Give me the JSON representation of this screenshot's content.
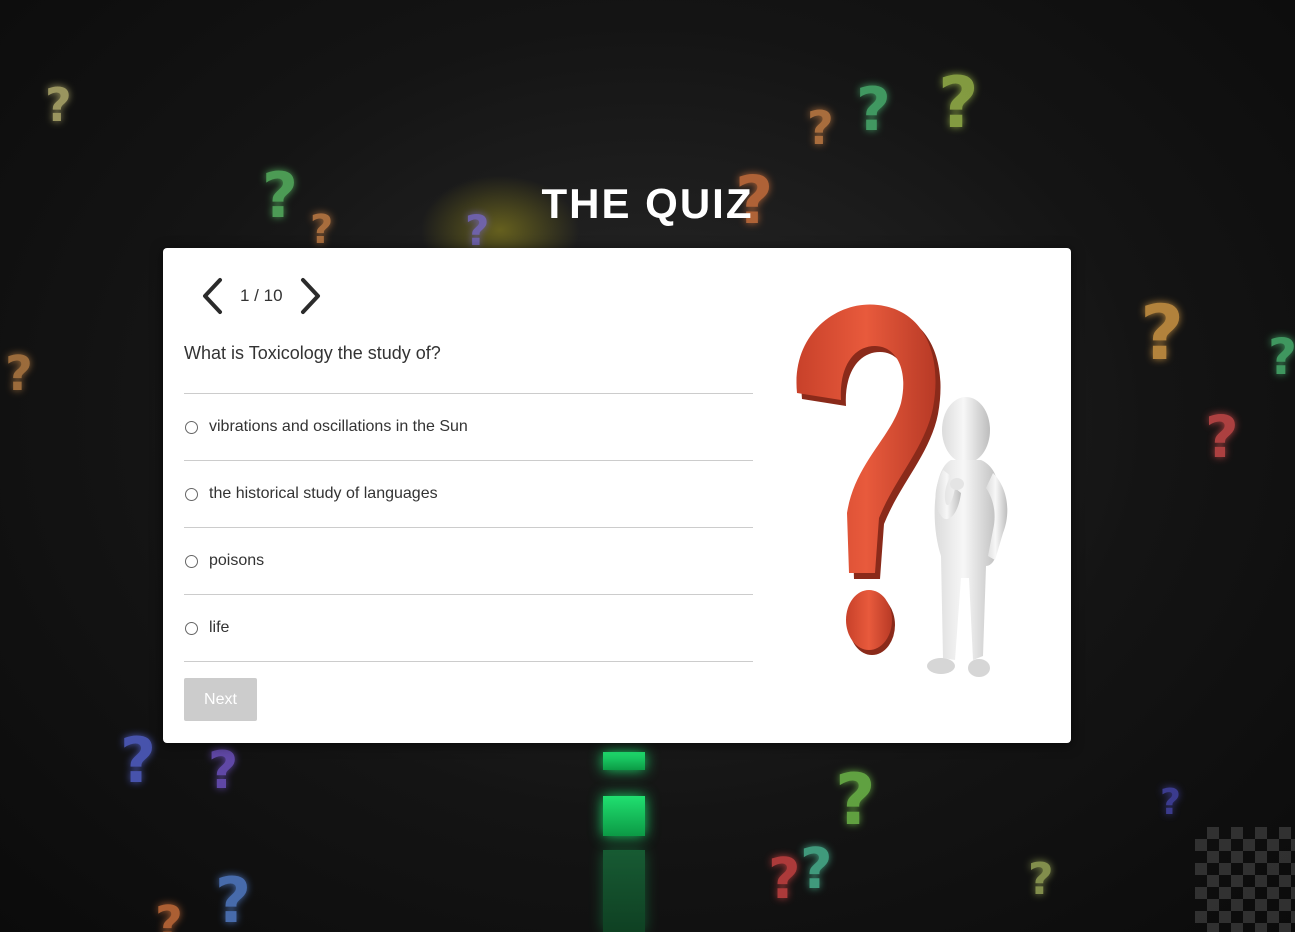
{
  "page": {
    "title": "THE QUIZ"
  },
  "quiz": {
    "counter": "1 / 10",
    "prev_icon": "chevron-left-icon",
    "next_icon": "chevron-right-icon",
    "question": "What is Toxicology the study of?",
    "options": [
      "vibrations and oscillations in the Sun",
      "the historical study of languages",
      "poisons",
      "life"
    ],
    "next_label": "Next",
    "illustration": "question-mark-figure-illustration"
  },
  "colors": {
    "card_bg": "#ffffff",
    "next_button_disabled": "#cccccc",
    "question_mark_red": "#e0553a",
    "background": "#141414"
  }
}
